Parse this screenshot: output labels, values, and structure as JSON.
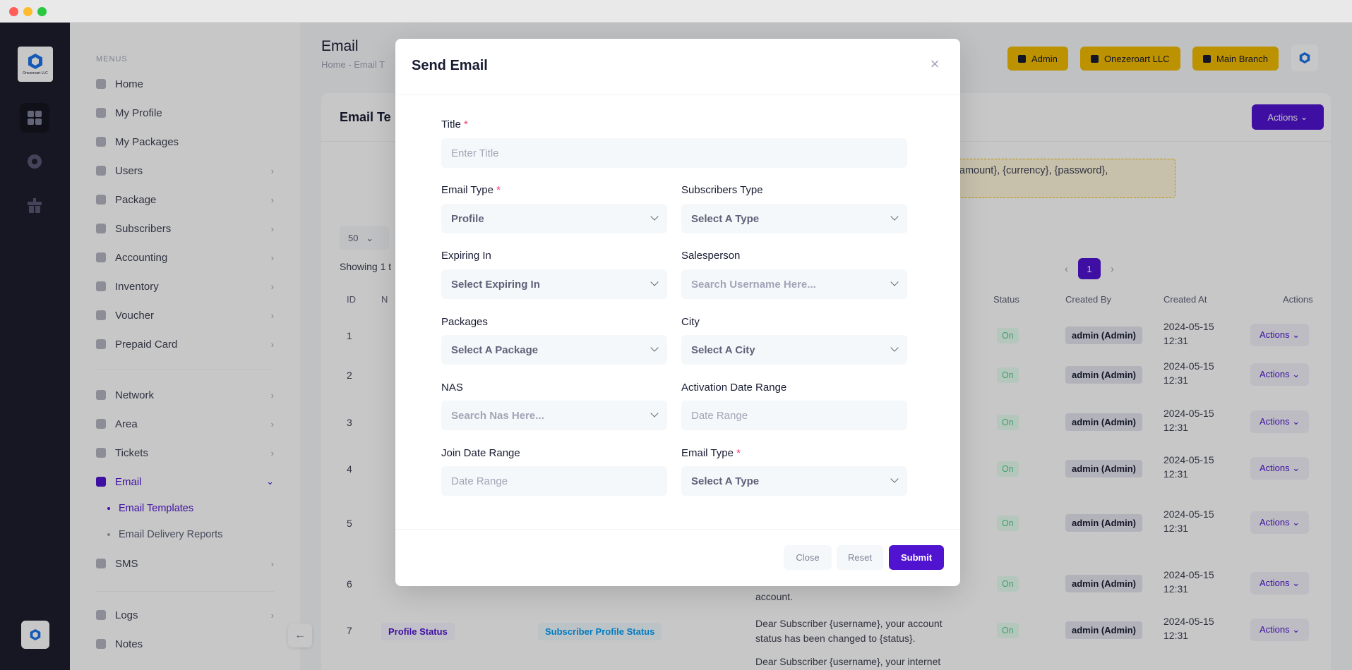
{
  "window": {
    "colors": {
      "close": "#ff5f57",
      "min": "#febc2e",
      "max": "#28c840"
    }
  },
  "rail": {
    "logo_text": "Onezeroart LLC",
    "icons": [
      "dashboard-icon",
      "settings-icon",
      "gift-icon"
    ]
  },
  "sidebar": {
    "section": "MENUS",
    "items": [
      {
        "label": "Home",
        "chevron": false
      },
      {
        "label": "My Profile",
        "chevron": false
      },
      {
        "label": "My Packages",
        "chevron": false
      },
      {
        "label": "Users",
        "chevron": true
      },
      {
        "label": "Package",
        "chevron": true
      },
      {
        "label": "Subscribers",
        "chevron": true
      },
      {
        "label": "Accounting",
        "chevron": true
      },
      {
        "label": "Inventory",
        "chevron": true
      },
      {
        "label": "Voucher",
        "chevron": true
      },
      {
        "label": "Prepaid Card",
        "chevron": true
      },
      {
        "label": "Network",
        "chevron": true
      },
      {
        "label": "Area",
        "chevron": true
      },
      {
        "label": "Tickets",
        "chevron": true
      },
      {
        "label": "Email",
        "chevron": true
      },
      {
        "label": "SMS",
        "chevron": true
      },
      {
        "label": "Logs",
        "chevron": true
      },
      {
        "label": "Notes",
        "chevron": false
      }
    ],
    "email_sub": [
      "Email Templates",
      "Email Delivery Reports"
    ]
  },
  "header": {
    "title": "Email",
    "breadcrumb": "Home  -  Email T",
    "buttons": [
      "Admin",
      "Onezeroart LLC",
      "Main Branch"
    ]
  },
  "card": {
    "title": "Email Te",
    "actions_label": "Actions",
    "note_text": ", {amount}, {currency}, {password},",
    "page_size": "50",
    "showing": "Showing 1 t",
    "page": "1",
    "columns": {
      "id": "ID",
      "n": "N",
      "status": "Status",
      "created_by": "Created By",
      "created_at": "Created At",
      "actions": "Actions"
    },
    "rows": [
      {
        "id": "1",
        "status": "On",
        "created_by": "admin (Admin)",
        "date": "2024-05-15",
        "time": "12:31",
        "action": "Actions"
      },
      {
        "id": "2",
        "status": "On",
        "created_by": "admin (Admin)",
        "date": "2024-05-15",
        "time": "12:31",
        "action": "Actions"
      },
      {
        "id": "3",
        "status": "On",
        "created_by": "admin (Admin)",
        "date": "2024-05-15",
        "time": "12:31",
        "action": "Actions"
      },
      {
        "id": "4",
        "status": "On",
        "created_by": "admin (Admin)",
        "date": "2024-05-15",
        "time": "12:31",
        "action": "Actions"
      },
      {
        "id": "5",
        "status": "On",
        "created_by": "admin (Admin)",
        "date": "2024-05-15",
        "time": "12:31",
        "action": "Actions"
      },
      {
        "id": "6",
        "status": "On",
        "created_by": "admin (Admin)",
        "date": "2024-05-15",
        "time": "12:31",
        "action": "Actions",
        "message": "account."
      },
      {
        "id": "7",
        "status": "On",
        "created_by": "admin (Admin)",
        "date": "2024-05-15",
        "time": "12:31",
        "action": "Actions",
        "name": "Profile Status",
        "subject": "Subscriber Profile Status",
        "message_1": "Dear Subscriber {username}, your account",
        "message_2": "status has been changed to {status}."
      }
    ],
    "row8_message": "Dear Subscriber {username}, your internet"
  },
  "modal": {
    "title": "Send Email",
    "fields": {
      "title": {
        "label": "Title",
        "placeholder": "Enter Title"
      },
      "email_type": {
        "label": "Email Type",
        "value": "Profile"
      },
      "subscribers_type": {
        "label": "Subscribers Type",
        "value": "Select A Type"
      },
      "expiring_in": {
        "label": "Expiring In",
        "value": "Select Expiring In"
      },
      "salesperson": {
        "label": "Salesperson",
        "value": "Search Username Here..."
      },
      "packages": {
        "label": "Packages",
        "value": "Select A Package"
      },
      "city": {
        "label": "City",
        "value": "Select A City"
      },
      "nas": {
        "label": "NAS",
        "value": "Search Nas Here..."
      },
      "activation_date": {
        "label": "Activation Date Range",
        "placeholder": "Date Range"
      },
      "join_date": {
        "label": "Join Date Range",
        "placeholder": "Date Range"
      },
      "email_type2": {
        "label": "Email Type",
        "value": "Select A Type"
      }
    },
    "required_mark": "*",
    "buttons": {
      "close": "Close",
      "reset": "Reset",
      "submit": "Submit"
    }
  },
  "colors": {
    "primary": "#5014d0",
    "warning": "#f1bc00",
    "success": "#50cd89",
    "danger": "#f1416c"
  }
}
